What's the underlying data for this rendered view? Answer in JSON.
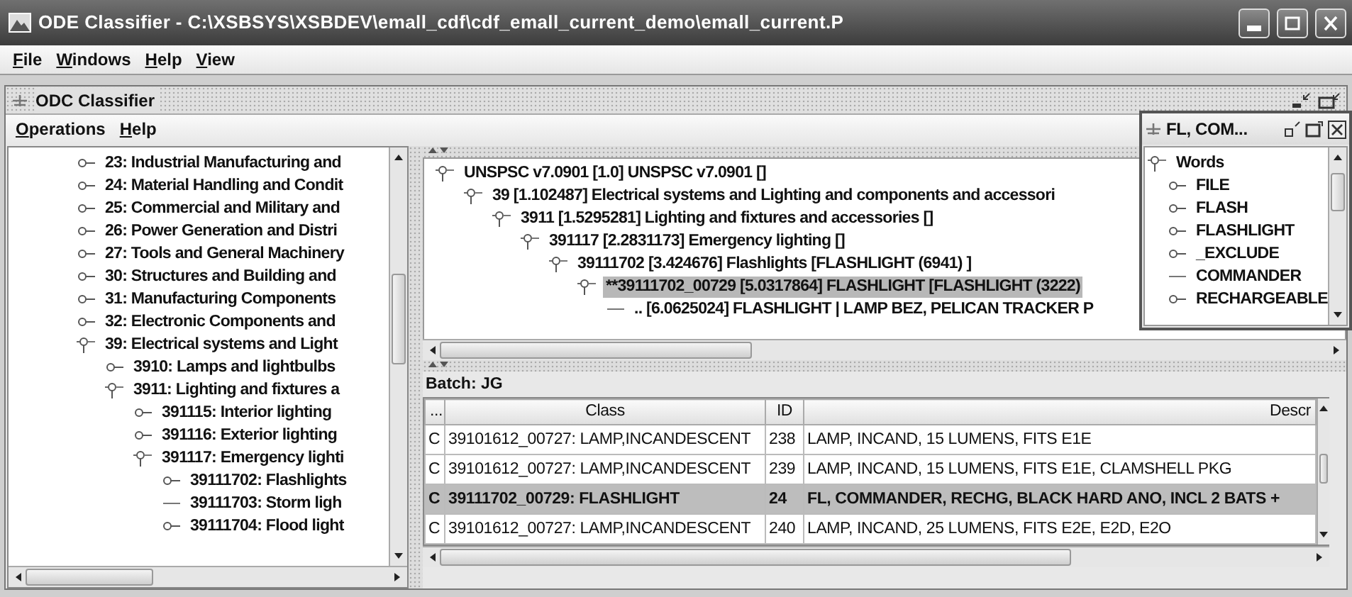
{
  "window": {
    "title": "ODE Classifier - C:\\XSBSYS\\XSBDEV\\emall_cdf\\cdf_emall_current_demo\\emall_current.P"
  },
  "menu": [
    "File",
    "Windows",
    "Help",
    "View"
  ],
  "inner_frame": {
    "title": "ODC Classifier",
    "menu": [
      "Operations",
      "Help"
    ]
  },
  "category_tree": [
    {
      "label": "23: Industrial Manufacturing and",
      "kind": "branch",
      "expanded": false,
      "selected": false
    },
    {
      "label": "24: Material Handling and Condit",
      "kind": "branch",
      "expanded": false,
      "selected": false
    },
    {
      "label": "25: Commercial and Military and",
      "kind": "branch",
      "expanded": false,
      "selected": false
    },
    {
      "label": "26: Power Generation and Distri",
      "kind": "branch",
      "expanded": false,
      "selected": false
    },
    {
      "label": "27: Tools and General Machinery",
      "kind": "branch",
      "expanded": false,
      "selected": false
    },
    {
      "label": "30: Structures and Building and",
      "kind": "branch",
      "expanded": false,
      "selected": false
    },
    {
      "label": "31: Manufacturing Components",
      "kind": "branch",
      "expanded": false,
      "selected": false
    },
    {
      "label": "32: Electronic Components and",
      "kind": "branch",
      "expanded": false,
      "selected": false
    },
    {
      "label": "39: Electrical systems and Light",
      "kind": "branch",
      "expanded": true,
      "selected": false,
      "children": [
        {
          "label": "3910: Lamps and lightbulbs",
          "kind": "branch",
          "expanded": false,
          "selected": false
        },
        {
          "label": "3911: Lighting and fixtures a",
          "kind": "branch",
          "expanded": true,
          "selected": false,
          "children": [
            {
              "label": "391115: Interior lighting",
              "kind": "branch",
              "expanded": false,
              "selected": false
            },
            {
              "label": "391116: Exterior lighting",
              "kind": "branch",
              "expanded": false,
              "selected": false
            },
            {
              "label": "391117: Emergency lighti",
              "kind": "branch",
              "expanded": true,
              "selected": false,
              "children": [
                {
                  "label": "39111702: Flashlights",
                  "kind": "branch",
                  "expanded": false,
                  "selected": false
                },
                {
                  "label": "39111703: Storm ligh",
                  "kind": "leaf",
                  "selected": false
                },
                {
                  "label": "39111704: Flood light",
                  "kind": "branch",
                  "expanded": false,
                  "selected": false
                }
              ]
            }
          ]
        }
      ]
    }
  ],
  "match_tree": [
    {
      "label": "UNSPSC v7.0901 [1.0] UNSPSC v7.0901 []",
      "kind": "branch",
      "expanded": true,
      "selected": false,
      "children": [
        {
          "label": "39 [1.102487] Electrical systems and Lighting and components and accessori",
          "kind": "branch",
          "expanded": true,
          "selected": false,
          "children": [
            {
              "label": "3911 [1.5295281] Lighting and fixtures and accessories []",
              "kind": "branch",
              "expanded": true,
              "selected": false,
              "children": [
                {
                  "label": "391117 [2.2831173] Emergency lighting []",
                  "kind": "branch",
                  "expanded": true,
                  "selected": false,
                  "children": [
                    {
                      "label": "39111702 [3.424676] Flashlights [FLASHLIGHT (6941) ]",
                      "kind": "branch",
                      "expanded": true,
                      "selected": false,
                      "children": [
                        {
                          "label": "**39111702_00729 [5.0317864] FLASHLIGHT [FLASHLIGHT (3222)",
                          "kind": "branch",
                          "expanded": true,
                          "selected": true,
                          "children": [
                            {
                              "label": ".. [6.0625024] FLASHLIGHT | LAMP BEZ, PELICAN TRACKER P",
                              "kind": "leaf",
                              "selected": false
                            }
                          ]
                        }
                      ]
                    }
                  ]
                }
              ]
            }
          ]
        }
      ]
    }
  ],
  "batch": {
    "label": "Batch: JG",
    "columns": [
      "...",
      "Class",
      "ID",
      "Descr"
    ],
    "rows": [
      {
        "cells": [
          "C",
          "39101612_00727: LAMP,INCANDESCENT",
          "238",
          "LAMP, INCAND, 15 LUMENS, FITS E1E"
        ],
        "selected": false
      },
      {
        "cells": [
          "C",
          "39101612_00727: LAMP,INCANDESCENT",
          "239",
          "LAMP, INCAND, 15 LUMENS, FITS E1E, CLAMSHELL PKG"
        ],
        "selected": false
      },
      {
        "cells": [
          "C",
          "39111702_00729: FLASHLIGHT",
          "24",
          "FL, COMMANDER, RECHG, BLACK HARD ANO, INCL 2 BATS +"
        ],
        "selected": true
      },
      {
        "cells": [
          "C",
          "39101612_00727: LAMP,INCANDESCENT",
          "240",
          "LAMP, INCAND, 25 LUMENS, FITS E2E, E2D, E2O"
        ],
        "selected": false
      }
    ]
  },
  "words_window": {
    "title": "FL, COM...",
    "tree": [
      {
        "label": "Words",
        "kind": "branch",
        "expanded": true,
        "selected": false,
        "children": [
          {
            "label": "FILE",
            "kind": "branch",
            "expanded": false,
            "selected": false
          },
          {
            "label": "FLASH",
            "kind": "branch",
            "expanded": false,
            "selected": false
          },
          {
            "label": "FLASHLIGHT",
            "kind": "branch",
            "expanded": false,
            "selected": false
          },
          {
            "label": "_EXCLUDE",
            "kind": "branch",
            "expanded": false,
            "selected": false
          },
          {
            "label": "COMMANDER",
            "kind": "leaf",
            "selected": false
          },
          {
            "label": "RECHARGEABLE",
            "kind": "branch",
            "expanded": false,
            "selected": false
          }
        ]
      }
    ]
  }
}
